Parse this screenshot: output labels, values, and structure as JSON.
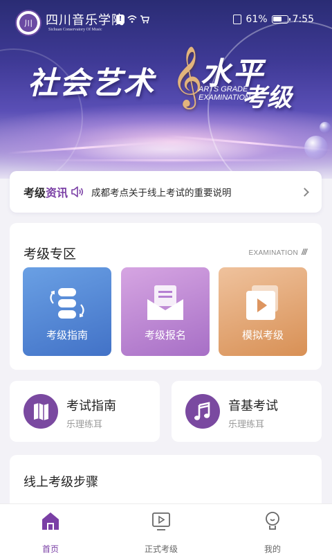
{
  "status_bar": {
    "school_name": "四川音乐学院",
    "school_name_en": "Sichuan Conservatory Of Music",
    "logo_text": "川",
    "battery": "61%",
    "battery_level": 0.61,
    "time": "7:55"
  },
  "banner": {
    "title_part1": "社会艺术",
    "title_part2": "水平",
    "title_part3": "考级",
    "subtitle_line1": "ARTS GRADE",
    "subtitle_line2": "EXAMINATION"
  },
  "notice": {
    "label_a": "考级",
    "label_b": "资讯",
    "text": "成都考点关于线上考试的重要说明"
  },
  "exam_zone": {
    "title": "考级专区",
    "title_en": "EXAMINATION",
    "tiles": [
      {
        "label": "考级指南"
      },
      {
        "label": "考级报名"
      },
      {
        "label": "模拟考级"
      }
    ]
  },
  "quick_cards": [
    {
      "title": "考试指南",
      "subtitle": "乐理练耳"
    },
    {
      "title": "音基考试",
      "subtitle": "乐理练耳"
    }
  ],
  "steps": {
    "title": "线上考级步骤"
  },
  "tabbar": {
    "items": [
      {
        "label": "首页"
      },
      {
        "label": "正式考级"
      },
      {
        "label": "我的"
      }
    ],
    "active_color": "#7a3fa5"
  }
}
